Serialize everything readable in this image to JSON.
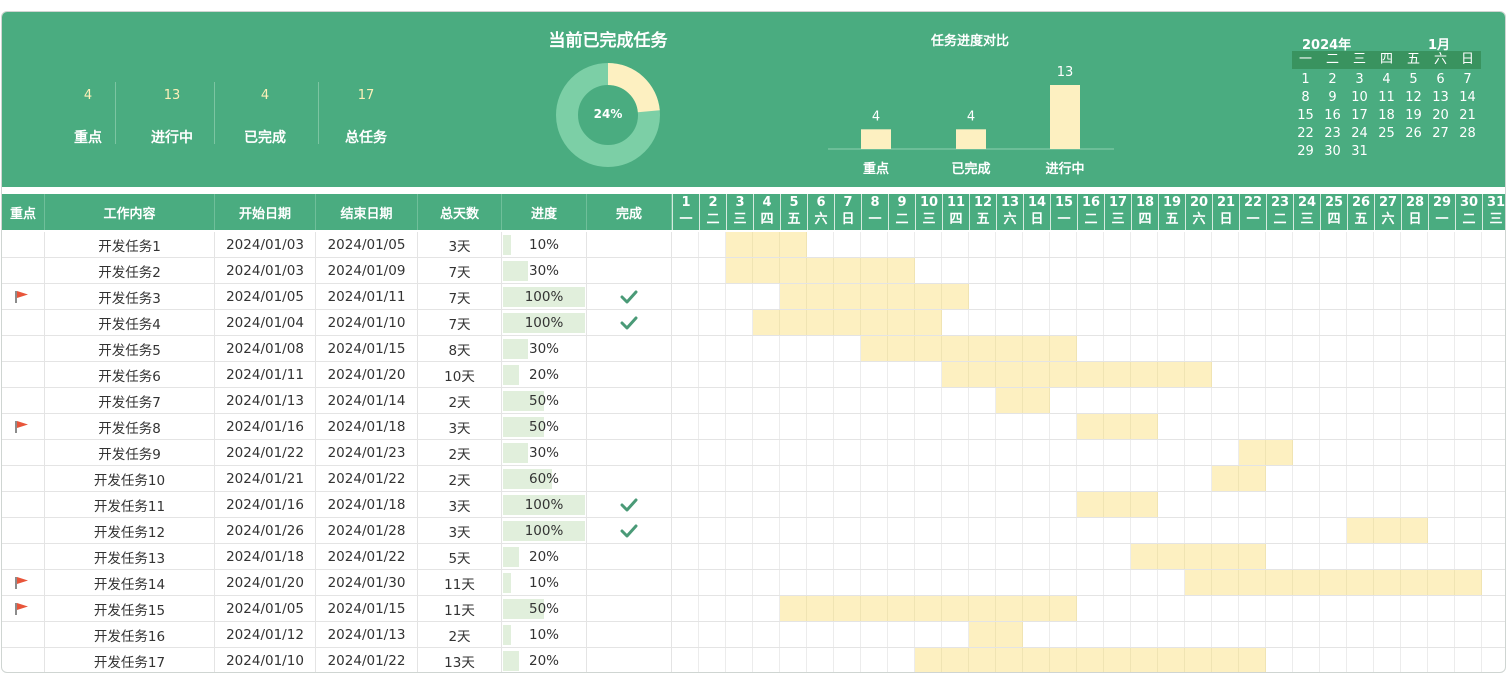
{
  "stats": [
    {
      "value": "4",
      "label": "重点"
    },
    {
      "value": "13",
      "label": "进行中"
    },
    {
      "value": "4",
      "label": "已完成"
    },
    {
      "value": "17",
      "label": "总任务"
    }
  ],
  "donut": {
    "title": "当前已完成任务",
    "percent_label": "24%",
    "fraction": 0.235
  },
  "bar_chart": {
    "title": "任务进度对比"
  },
  "chart_data": {
    "type": "bar",
    "title": "任务进度对比",
    "categories": [
      "重点",
      "已完成",
      "进行中"
    ],
    "values": [
      4,
      4,
      13
    ],
    "ylim": [
      0,
      13
    ]
  },
  "calendar": {
    "year_label": "2024年",
    "month_label": "1月",
    "weekdays": [
      "一",
      "二",
      "三",
      "四",
      "五",
      "六",
      "日"
    ],
    "weeks": [
      [
        "1",
        "2",
        "3",
        "4",
        "5",
        "6",
        "7"
      ],
      [
        "8",
        "9",
        "10",
        "11",
        "12",
        "13",
        "14"
      ],
      [
        "15",
        "16",
        "17",
        "18",
        "19",
        "20",
        "21"
      ],
      [
        "22",
        "23",
        "24",
        "25",
        "26",
        "27",
        "28"
      ],
      [
        "29",
        "30",
        "31",
        "",
        "",
        "",
        ""
      ]
    ]
  },
  "columns": {
    "key": "重点",
    "task": "工作内容",
    "start": "开始日期",
    "end": "结束日期",
    "days": "总天数",
    "progress": "进度",
    "done": "完成"
  },
  "days": [
    {
      "d": "1",
      "w": "一"
    },
    {
      "d": "2",
      "w": "二"
    },
    {
      "d": "3",
      "w": "三"
    },
    {
      "d": "4",
      "w": "四"
    },
    {
      "d": "5",
      "w": "五"
    },
    {
      "d": "6",
      "w": "六"
    },
    {
      "d": "7",
      "w": "日"
    },
    {
      "d": "8",
      "w": "一"
    },
    {
      "d": "9",
      "w": "二"
    },
    {
      "d": "10",
      "w": "三"
    },
    {
      "d": "11",
      "w": "四"
    },
    {
      "d": "12",
      "w": "五"
    },
    {
      "d": "13",
      "w": "六"
    },
    {
      "d": "14",
      "w": "日"
    },
    {
      "d": "15",
      "w": "一"
    },
    {
      "d": "16",
      "w": "二"
    },
    {
      "d": "17",
      "w": "三"
    },
    {
      "d": "18",
      "w": "四"
    },
    {
      "d": "19",
      "w": "五"
    },
    {
      "d": "20",
      "w": "六"
    },
    {
      "d": "21",
      "w": "日"
    },
    {
      "d": "22",
      "w": "一"
    },
    {
      "d": "23",
      "w": "二"
    },
    {
      "d": "24",
      "w": "三"
    },
    {
      "d": "25",
      "w": "四"
    },
    {
      "d": "26",
      "w": "五"
    },
    {
      "d": "27",
      "w": "六"
    },
    {
      "d": "28",
      "w": "日"
    },
    {
      "d": "29",
      "w": "一"
    },
    {
      "d": "30",
      "w": "二"
    },
    {
      "d": "31",
      "w": "三"
    }
  ],
  "tasks": [
    {
      "key": false,
      "name": "开发任务1",
      "start": "2024/01/03",
      "end": "2024/01/05",
      "days": "3天",
      "progress": "10%",
      "progress_value": 0.1,
      "done": false
    },
    {
      "key": false,
      "name": "开发任务2",
      "start": "2024/01/03",
      "end": "2024/01/09",
      "days": "7天",
      "progress": "30%",
      "progress_value": 0.3,
      "done": false
    },
    {
      "key": true,
      "name": "开发任务3",
      "start": "2024/01/05",
      "end": "2024/01/11",
      "days": "7天",
      "progress": "100%",
      "progress_value": 1.0,
      "done": true
    },
    {
      "key": false,
      "name": "开发任务4",
      "start": "2024/01/04",
      "end": "2024/01/10",
      "days": "7天",
      "progress": "100%",
      "progress_value": 1.0,
      "done": true
    },
    {
      "key": false,
      "name": "开发任务5",
      "start": "2024/01/08",
      "end": "2024/01/15",
      "days": "8天",
      "progress": "30%",
      "progress_value": 0.3,
      "done": false
    },
    {
      "key": false,
      "name": "开发任务6",
      "start": "2024/01/11",
      "end": "2024/01/20",
      "days": "10天",
      "progress": "20%",
      "progress_value": 0.2,
      "done": false
    },
    {
      "key": false,
      "name": "开发任务7",
      "start": "2024/01/13",
      "end": "2024/01/14",
      "days": "2天",
      "progress": "50%",
      "progress_value": 0.5,
      "done": false
    },
    {
      "key": true,
      "name": "开发任务8",
      "start": "2024/01/16",
      "end": "2024/01/18",
      "days": "3天",
      "progress": "50%",
      "progress_value": 0.5,
      "done": false
    },
    {
      "key": false,
      "name": "开发任务9",
      "start": "2024/01/22",
      "end": "2024/01/23",
      "days": "2天",
      "progress": "30%",
      "progress_value": 0.3,
      "done": false
    },
    {
      "key": false,
      "name": "开发任务10",
      "start": "2024/01/21",
      "end": "2024/01/22",
      "days": "2天",
      "progress": "60%",
      "progress_value": 0.6,
      "done": false
    },
    {
      "key": false,
      "name": "开发任务11",
      "start": "2024/01/16",
      "end": "2024/01/18",
      "days": "3天",
      "progress": "100%",
      "progress_value": 1.0,
      "done": true
    },
    {
      "key": false,
      "name": "开发任务12",
      "start": "2024/01/26",
      "end": "2024/01/28",
      "days": "3天",
      "progress": "100%",
      "progress_value": 1.0,
      "done": true
    },
    {
      "key": false,
      "name": "开发任务13",
      "start": "2024/01/18",
      "end": "2024/01/22",
      "days": "5天",
      "progress": "20%",
      "progress_value": 0.2,
      "done": false
    },
    {
      "key": true,
      "name": "开发任务14",
      "start": "2024/01/20",
      "end": "2024/01/30",
      "days": "11天",
      "progress": "10%",
      "progress_value": 0.1,
      "done": false
    },
    {
      "key": true,
      "name": "开发任务15",
      "start": "2024/01/05",
      "end": "2024/01/15",
      "days": "11天",
      "progress": "50%",
      "progress_value": 0.5,
      "done": false
    },
    {
      "key": false,
      "name": "开发任务16",
      "start": "2024/01/12",
      "end": "2024/01/13",
      "days": "2天",
      "progress": "10%",
      "progress_value": 0.1,
      "done": false
    },
    {
      "key": false,
      "name": "开发任务17",
      "start": "2024/01/10",
      "end": "2024/01/22",
      "days": "13天",
      "progress": "20%",
      "progress_value": 0.2,
      "done": false
    }
  ],
  "colors": {
    "header_green": "#4aac80",
    "bar_yellow": "#fdf0c1",
    "progress_fill": "#e1efdc",
    "flag_red": "#e8553a",
    "check_green": "#4a9a77"
  }
}
